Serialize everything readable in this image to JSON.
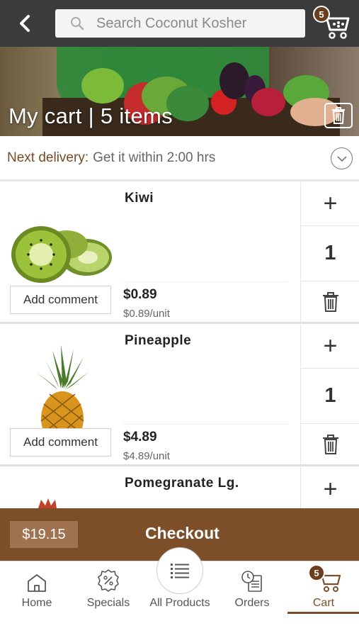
{
  "header": {
    "search_placeholder": "Search Coconut Kosher",
    "cart_count": "5",
    "icons": {
      "back": "back-arrow-icon",
      "search": "search-icon",
      "cart": "cart-icon"
    }
  },
  "hero": {
    "title": "My cart | 5 items",
    "trash_icon": "trash-icon"
  },
  "delivery": {
    "label": "Next delivery:",
    "value": "Get it within 2:00 hrs"
  },
  "items": [
    {
      "name": "Kiwi",
      "price": "$0.89",
      "unit_price": "$0.89/unit",
      "qty": "1",
      "comment_label": "Add comment",
      "plus": "+"
    },
    {
      "name": "Pineapple",
      "price": "$4.89",
      "unit_price": "$4.89/unit",
      "qty": "1",
      "comment_label": "Add comment",
      "plus": "+"
    },
    {
      "name": "Pomegranate Lg.",
      "plus": "+"
    }
  ],
  "checkout": {
    "total": "$19.15",
    "label": "Checkout"
  },
  "nav": {
    "items": [
      {
        "label": "Home"
      },
      {
        "label": "Specials"
      },
      {
        "label": "All Products"
      },
      {
        "label": "Orders"
      },
      {
        "label": "Cart",
        "badge": "5"
      }
    ],
    "active": "Cart"
  },
  "colors": {
    "accent": "#7d4f28",
    "topbar": "#3b3b3b",
    "badge": "#6b3e1d"
  }
}
